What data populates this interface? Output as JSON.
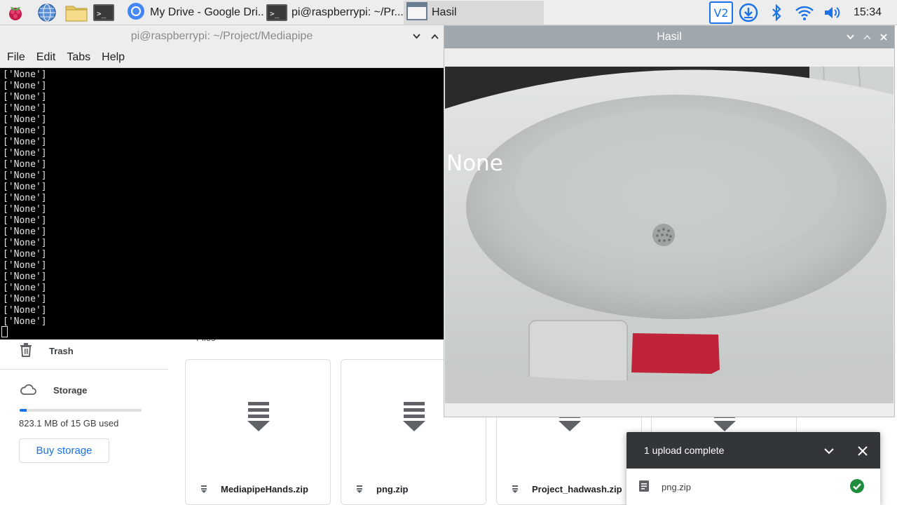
{
  "taskbar": {
    "launchers": [
      {
        "icon": "raspberry-menu-icon"
      },
      {
        "icon": "web-browser-icon"
      },
      {
        "icon": "file-manager-icon"
      },
      {
        "icon": "terminal-icon"
      }
    ],
    "tasks": [
      {
        "label": "My Drive - Google Dri...",
        "icon": "chromium-icon",
        "active": false
      },
      {
        "label": "pi@raspberrypi: ~/Pr...",
        "icon": "terminal-icon",
        "active": false
      },
      {
        "label": "Hasil",
        "icon": "window-icon",
        "active": true
      }
    ],
    "tray": [
      "vnc-icon",
      "download-icon",
      "bluetooth-icon",
      "wifi-icon",
      "volume-icon"
    ],
    "clock": "15:34"
  },
  "terminal": {
    "title": "pi@raspberrypi: ~/Project/Mediapipe",
    "menu": {
      "file": "File",
      "edit": "Edit",
      "tabs": "Tabs",
      "help": "Help"
    },
    "lines": [
      "['None']",
      "['None']",
      "['None']",
      "['None']",
      "['None']",
      "['None']",
      "['None']",
      "['None']",
      "['None']",
      "['None']",
      "['None']",
      "['None']",
      "['None']",
      "['None']",
      "['None']",
      "['None']",
      "['None']",
      "['None']",
      "['None']",
      "['None']",
      "['None']",
      "['None']",
      "['None']"
    ]
  },
  "hasil": {
    "title": "Hasil",
    "overlay_text": "None"
  },
  "drive": {
    "sidebar": {
      "trash_label": "Trash",
      "storage_label": "Storage",
      "storage_used": "823.1 MB of 15 GB used",
      "storage_fraction": 0.055,
      "buy_storage": "Buy storage"
    },
    "files_heading": "Files",
    "files": [
      {
        "name": "MediapipeHands.zip"
      },
      {
        "name": "png.zip"
      },
      {
        "name": "Project_hadwash.zip"
      },
      {
        "name": ""
      }
    ],
    "accent": "#1a73e8"
  },
  "upload_toast": {
    "title": "1 upload complete",
    "file": "png.zip",
    "success_color": "#1e8e3e"
  }
}
